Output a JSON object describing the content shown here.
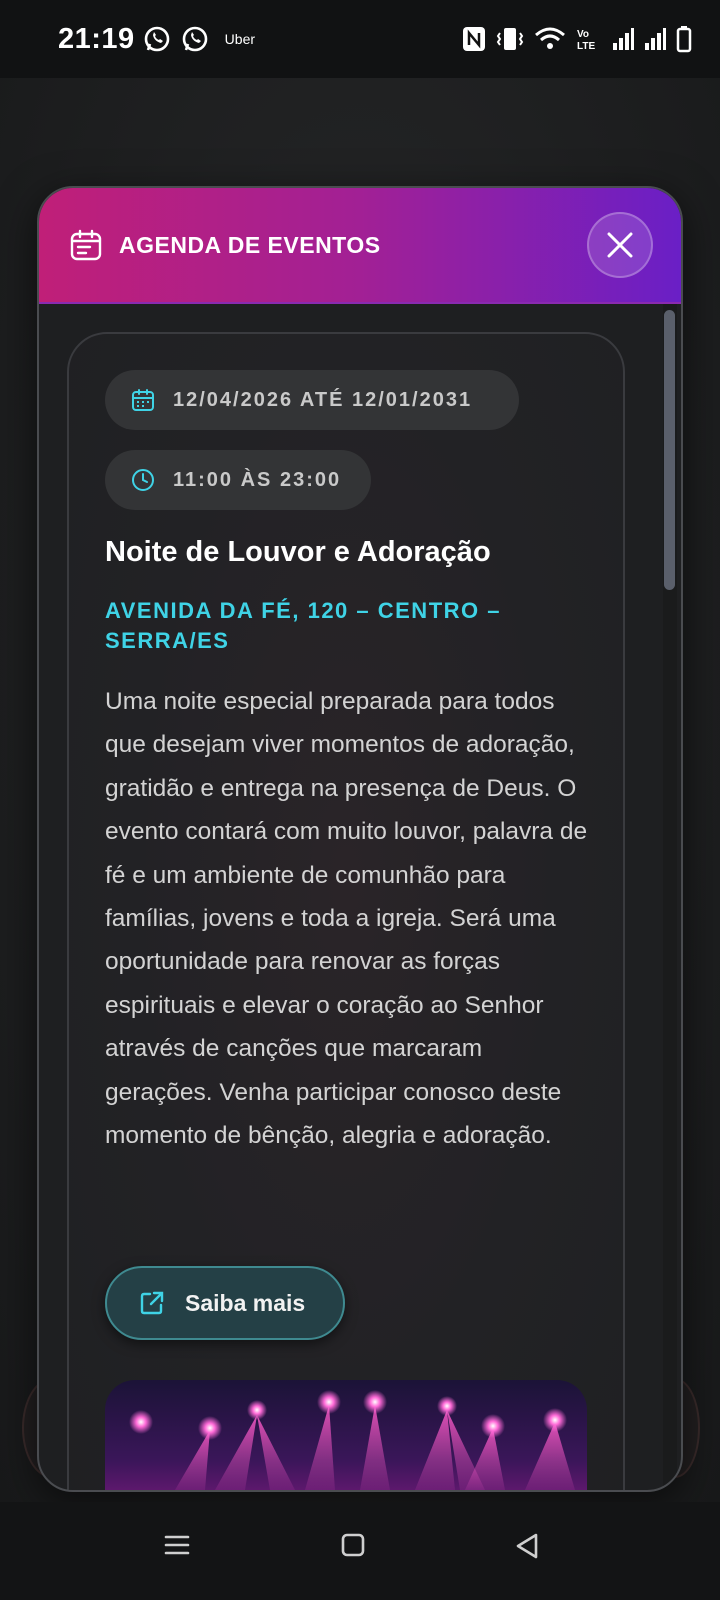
{
  "status_bar": {
    "time": "21:19",
    "notification_icons": [
      "whatsapp-icon",
      "whatsapp-icon"
    ],
    "uber_label": "Uber",
    "right_icons": [
      "nfc-icon",
      "vibrate-icon",
      "wifi-icon",
      "volte-icon",
      "signal-icon",
      "signal-icon",
      "battery-icon"
    ]
  },
  "modal": {
    "header": {
      "icon": "calendar-icon",
      "title": "AGENDA DE EVENTOS",
      "close_icon": "close-icon"
    },
    "event": {
      "date_icon": "calendar-icon",
      "date_range": "12/04/2026 ATÉ 12/01/2031",
      "time_icon": "clock-icon",
      "time_range": "11:00 ÀS 23:00",
      "title": "Noite de Louvor e Adoração",
      "location": "AVENIDA DA FÉ, 120 – CENTRO – SERRA/ES",
      "description": "Uma noite especial preparada para todos que desejam viver momentos de adoração, gratidão e entrega na presença de Deus. O evento contará com muito louvor, palavra de fé e um ambiente de comunhão para famílias, jovens e toda a igreja. Será uma oportunidade para renovar as forças espirituais e elevar o coração ao Senhor através de canções que marcaram gerações. Venha participar conosco deste momento de bênção, alegria e adoração.",
      "more_button_icon": "external-link-icon",
      "more_button_label": "Saiba mais"
    }
  },
  "nav_bar": {
    "items": [
      "recent-apps-icon",
      "home-icon",
      "back-icon"
    ]
  },
  "colors": {
    "header_gradient_start": "#c01f78",
    "header_gradient_end": "#6a1fc6",
    "accent_cyan": "#3fd3e6",
    "button_border": "#3f8a90"
  }
}
